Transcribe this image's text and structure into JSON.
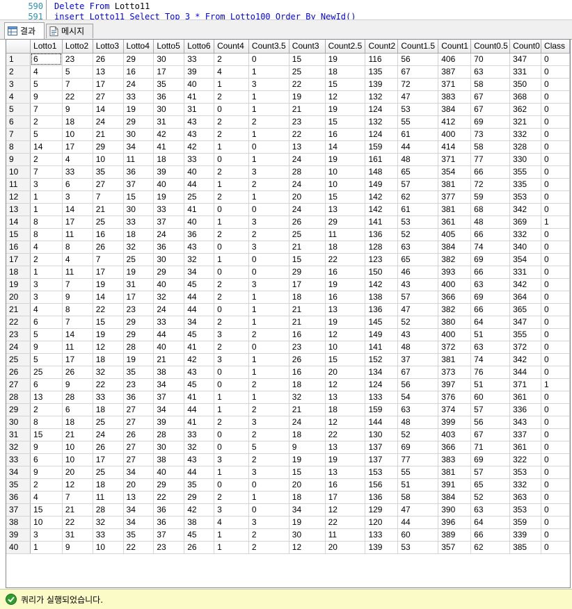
{
  "editor": {
    "line_numbers": [
      "590",
      "591"
    ],
    "line1": {
      "kw1": "Delete",
      "kw2": "From",
      "rest": " Lotto11"
    },
    "line2_partial": "insert Lotto11 Select Top 3 * From Lotto100 Order By NewId()"
  },
  "tabs": [
    {
      "label": "결과",
      "icon": "grid-icon",
      "active": true
    },
    {
      "label": "메시지",
      "icon": "message-icon",
      "active": false
    }
  ],
  "grid": {
    "columns": [
      "Lotto1",
      "Lotto2",
      "Lotto3",
      "Lotto4",
      "Lotto5",
      "Lotto6",
      "Count4",
      "Count3.5",
      "Count3",
      "Count2.5",
      "Count2",
      "Count1.5",
      "Count1",
      "Count0.5",
      "Count0",
      "Class"
    ],
    "rows": [
      [
        "6",
        "23",
        "26",
        "29",
        "30",
        "33",
        "2",
        "0",
        "15",
        "19",
        "116",
        "56",
        "406",
        "70",
        "347",
        "0"
      ],
      [
        "4",
        "5",
        "13",
        "16",
        "17",
        "39",
        "4",
        "1",
        "25",
        "18",
        "135",
        "67",
        "387",
        "63",
        "331",
        "0"
      ],
      [
        "5",
        "7",
        "17",
        "24",
        "35",
        "40",
        "1",
        "3",
        "22",
        "15",
        "139",
        "72",
        "371",
        "58",
        "350",
        "0"
      ],
      [
        "9",
        "22",
        "27",
        "33",
        "36",
        "41",
        "2",
        "1",
        "19",
        "12",
        "132",
        "47",
        "383",
        "67",
        "368",
        "0"
      ],
      [
        "7",
        "9",
        "14",
        "19",
        "30",
        "31",
        "0",
        "1",
        "21",
        "19",
        "124",
        "53",
        "384",
        "67",
        "362",
        "0"
      ],
      [
        "2",
        "18",
        "24",
        "29",
        "31",
        "43",
        "2",
        "2",
        "23",
        "15",
        "132",
        "55",
        "412",
        "69",
        "321",
        "0"
      ],
      [
        "5",
        "10",
        "21",
        "30",
        "42",
        "43",
        "2",
        "1",
        "22",
        "16",
        "124",
        "61",
        "400",
        "73",
        "332",
        "0"
      ],
      [
        "14",
        "17",
        "29",
        "34",
        "41",
        "42",
        "1",
        "0",
        "13",
        "14",
        "159",
        "44",
        "414",
        "58",
        "328",
        "0"
      ],
      [
        "2",
        "4",
        "10",
        "11",
        "18",
        "33",
        "0",
        "1",
        "24",
        "19",
        "161",
        "48",
        "371",
        "77",
        "330",
        "0"
      ],
      [
        "7",
        "33",
        "35",
        "36",
        "39",
        "40",
        "2",
        "3",
        "28",
        "10",
        "148",
        "65",
        "354",
        "66",
        "355",
        "0"
      ],
      [
        "3",
        "6",
        "27",
        "37",
        "40",
        "44",
        "1",
        "2",
        "24",
        "10",
        "149",
        "57",
        "381",
        "72",
        "335",
        "0"
      ],
      [
        "1",
        "3",
        "7",
        "15",
        "19",
        "25",
        "2",
        "1",
        "20",
        "15",
        "142",
        "62",
        "377",
        "59",
        "353",
        "0"
      ],
      [
        "1",
        "14",
        "21",
        "30",
        "33",
        "41",
        "0",
        "0",
        "24",
        "13",
        "142",
        "61",
        "381",
        "68",
        "342",
        "0"
      ],
      [
        "8",
        "17",
        "25",
        "33",
        "37",
        "40",
        "1",
        "3",
        "26",
        "29",
        "141",
        "53",
        "361",
        "48",
        "369",
        "1"
      ],
      [
        "8",
        "11",
        "16",
        "18",
        "24",
        "36",
        "2",
        "2",
        "25",
        "11",
        "136",
        "52",
        "405",
        "66",
        "332",
        "0"
      ],
      [
        "4",
        "8",
        "26",
        "32",
        "36",
        "43",
        "0",
        "3",
        "21",
        "18",
        "128",
        "63",
        "384",
        "74",
        "340",
        "0"
      ],
      [
        "2",
        "4",
        "7",
        "25",
        "30",
        "32",
        "1",
        "0",
        "15",
        "22",
        "123",
        "65",
        "382",
        "69",
        "354",
        "0"
      ],
      [
        "1",
        "11",
        "17",
        "19",
        "29",
        "34",
        "0",
        "0",
        "29",
        "16",
        "150",
        "46",
        "393",
        "66",
        "331",
        "0"
      ],
      [
        "3",
        "7",
        "19",
        "31",
        "40",
        "45",
        "2",
        "3",
        "17",
        "19",
        "142",
        "43",
        "400",
        "63",
        "342",
        "0"
      ],
      [
        "3",
        "9",
        "14",
        "17",
        "32",
        "44",
        "2",
        "1",
        "18",
        "16",
        "138",
        "57",
        "366",
        "69",
        "364",
        "0"
      ],
      [
        "4",
        "8",
        "22",
        "23",
        "24",
        "44",
        "0",
        "1",
        "21",
        "13",
        "136",
        "47",
        "382",
        "66",
        "365",
        "0"
      ],
      [
        "6",
        "7",
        "15",
        "29",
        "33",
        "34",
        "2",
        "1",
        "21",
        "19",
        "145",
        "52",
        "380",
        "64",
        "347",
        "0"
      ],
      [
        "5",
        "14",
        "19",
        "29",
        "44",
        "45",
        "3",
        "2",
        "16",
        "12",
        "149",
        "43",
        "400",
        "51",
        "355",
        "0"
      ],
      [
        "9",
        "11",
        "12",
        "28",
        "40",
        "41",
        "2",
        "0",
        "23",
        "10",
        "141",
        "48",
        "372",
        "63",
        "372",
        "0"
      ],
      [
        "5",
        "17",
        "18",
        "19",
        "21",
        "42",
        "3",
        "1",
        "26",
        "15",
        "152",
        "37",
        "381",
        "74",
        "342",
        "0"
      ],
      [
        "25",
        "26",
        "32",
        "35",
        "38",
        "43",
        "0",
        "1",
        "16",
        "20",
        "134",
        "67",
        "373",
        "76",
        "344",
        "0"
      ],
      [
        "6",
        "9",
        "22",
        "23",
        "34",
        "45",
        "0",
        "2",
        "18",
        "12",
        "124",
        "56",
        "397",
        "51",
        "371",
        "1"
      ],
      [
        "13",
        "28",
        "33",
        "36",
        "37",
        "41",
        "1",
        "1",
        "32",
        "13",
        "133",
        "54",
        "376",
        "60",
        "361",
        "0"
      ],
      [
        "2",
        "6",
        "18",
        "27",
        "34",
        "44",
        "1",
        "2",
        "21",
        "18",
        "159",
        "63",
        "374",
        "57",
        "336",
        "0"
      ],
      [
        "8",
        "18",
        "25",
        "27",
        "39",
        "41",
        "2",
        "3",
        "24",
        "12",
        "144",
        "48",
        "399",
        "56",
        "343",
        "0"
      ],
      [
        "15",
        "21",
        "24",
        "26",
        "28",
        "33",
        "0",
        "2",
        "18",
        "22",
        "130",
        "52",
        "403",
        "67",
        "337",
        "0"
      ],
      [
        "9",
        "10",
        "26",
        "27",
        "30",
        "32",
        "0",
        "5",
        "9",
        "13",
        "137",
        "69",
        "366",
        "71",
        "361",
        "0"
      ],
      [
        "6",
        "10",
        "17",
        "27",
        "38",
        "43",
        "3",
        "2",
        "19",
        "19",
        "137",
        "77",
        "383",
        "69",
        "322",
        "0"
      ],
      [
        "9",
        "20",
        "25",
        "34",
        "40",
        "44",
        "1",
        "3",
        "15",
        "13",
        "153",
        "55",
        "381",
        "57",
        "353",
        "0"
      ],
      [
        "2",
        "12",
        "18",
        "20",
        "29",
        "35",
        "0",
        "0",
        "20",
        "16",
        "156",
        "51",
        "391",
        "65",
        "332",
        "0"
      ],
      [
        "4",
        "7",
        "11",
        "13",
        "22",
        "29",
        "2",
        "1",
        "18",
        "17",
        "136",
        "58",
        "384",
        "52",
        "363",
        "0"
      ],
      [
        "15",
        "21",
        "28",
        "34",
        "36",
        "42",
        "3",
        "0",
        "34",
        "12",
        "129",
        "47",
        "390",
        "63",
        "353",
        "0"
      ],
      [
        "10",
        "22",
        "32",
        "34",
        "36",
        "38",
        "4",
        "3",
        "19",
        "22",
        "120",
        "44",
        "396",
        "64",
        "359",
        "0"
      ],
      [
        "3",
        "31",
        "33",
        "35",
        "37",
        "45",
        "1",
        "2",
        "30",
        "11",
        "133",
        "60",
        "389",
        "66",
        "339",
        "0"
      ],
      [
        "1",
        "9",
        "10",
        "22",
        "23",
        "26",
        "1",
        "2",
        "12",
        "20",
        "139",
        "53",
        "357",
        "62",
        "385",
        "0"
      ]
    ]
  },
  "status": {
    "message": "쿼리가 실행되었습니다.",
    "icon": "success-check-icon",
    "color": "#fbfbc8"
  }
}
